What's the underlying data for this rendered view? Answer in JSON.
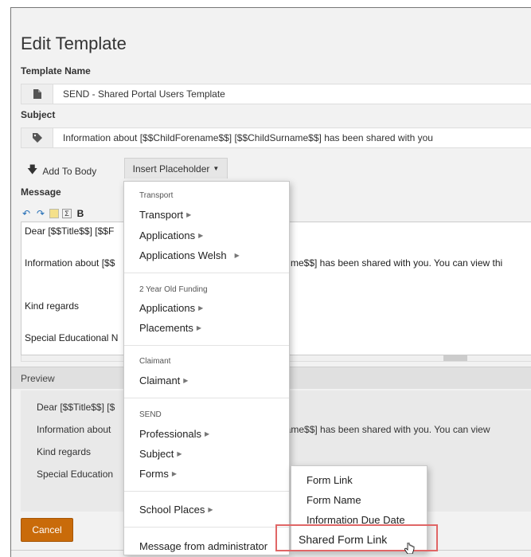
{
  "page": {
    "title": "Edit Template",
    "template_name_label": "Template Name",
    "template_name_value": "SEND - Shared Portal Users Template",
    "subject_label": "Subject",
    "subject_value": "Information about [$$ChildForename$$] [$$ChildSurname$$] has been shared with you",
    "add_to_body": "Add To Body",
    "insert_placeholder": "Insert Placeholder",
    "message_label": "Message",
    "editor_lines": [
      "Dear [$$Title$$] [$$F",
      "Information about [$$",
      "me$$] has been shared with you. You can view thi",
      "Kind regards",
      "Special Educational N"
    ],
    "preview_label": "Preview",
    "preview_lines": [
      "Dear [$$Title$$] [$",
      "Information about",
      "name$$] has been shared with you. You can view",
      "Kind regards",
      "Special Education"
    ],
    "cancel": "Cancel"
  },
  "dropdown": {
    "sections": [
      {
        "header": "Transport",
        "items": [
          "Transport",
          "Applications",
          "Applications Welsh"
        ]
      },
      {
        "header": "2 Year Old Funding",
        "items": [
          "Applications",
          "Placements"
        ]
      },
      {
        "header": "Claimant",
        "items": [
          "Claimant"
        ]
      },
      {
        "header": "SEND",
        "items": [
          "Professionals",
          "Subject",
          "Forms"
        ]
      },
      {
        "header": "",
        "items": [
          "School Places"
        ]
      },
      {
        "header": "",
        "items": [
          "Message from administrator"
        ]
      }
    ]
  },
  "submenu": {
    "items": [
      "Form Link",
      "Form Name",
      "Information Due Date",
      "Shared Form Link"
    ],
    "highlighted": "Shared Form Link"
  },
  "colors": {
    "cancel": "#c96b0a",
    "highlight_border": "#e06666",
    "editor_icons": "#1f6bb5"
  }
}
